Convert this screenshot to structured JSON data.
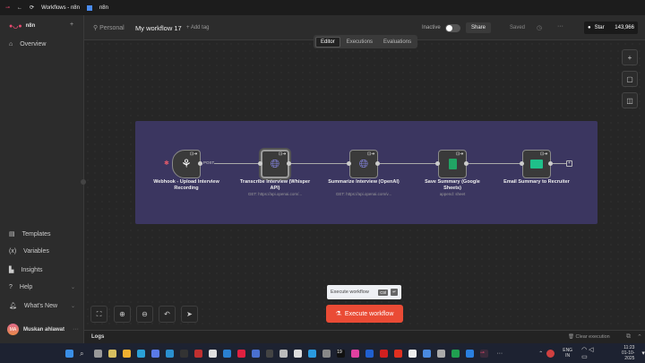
{
  "browser": {
    "tab_title": "Workflows - n8n",
    "tab2_title": "n8n"
  },
  "sidebar": {
    "brand": "n8n",
    "add": "+",
    "items": [
      {
        "label": "Overview",
        "icon": "home-icon"
      },
      {
        "label": "Templates",
        "icon": "templates-icon"
      },
      {
        "label": "Variables",
        "icon": "variables-icon"
      },
      {
        "label": "Insights",
        "icon": "insights-icon"
      },
      {
        "label": "Help",
        "icon": "help-icon"
      },
      {
        "label": "What's New",
        "icon": "bell-icon"
      }
    ],
    "user": {
      "initials": "MA",
      "name": "Muskan ahlawat"
    }
  },
  "header": {
    "project": "Personal",
    "workflow_name": "My workflow 17",
    "add_tag": "+ Add tag",
    "status": "Inactive",
    "share": "Share",
    "saved": "Saved",
    "more": "···",
    "github_star": "Star",
    "star_count": "143,966"
  },
  "tabs": [
    "Editor",
    "Executions",
    "Evaluations"
  ],
  "nodes": [
    {
      "title": "Webhook - Upload Interview Recording",
      "subtitle": "",
      "output_label": "POST",
      "icon": "webhook-icon"
    },
    {
      "title": "Transcribe Interview (Whisper API)",
      "subtitle": "GET: https://api.openai.com/...",
      "icon": "globe-icon"
    },
    {
      "title": "Summarize Interview (OpenAI)",
      "subtitle": "GET: https://api.openai.com/v...",
      "icon": "globe-icon"
    },
    {
      "title": "Save Summary (Google Sheets)",
      "subtitle": "append: sheet",
      "icon": "google-sheets-icon"
    },
    {
      "title": "Email Summary to Recruiter",
      "subtitle": "",
      "icon": "email-icon"
    }
  ],
  "execute": {
    "tooltip": "Execute workflow",
    "key1": "Ctrl",
    "key2": "↵",
    "button": "Execute workflow"
  },
  "logs": {
    "label": "Logs",
    "clear": "Clear execution"
  },
  "taskbar": {
    "lang": "ENG",
    "region": "IN",
    "time": "11:23",
    "date": "01-10-2025"
  },
  "colors": {
    "accent": "#ea4b35",
    "sticky": "#3b3660"
  }
}
